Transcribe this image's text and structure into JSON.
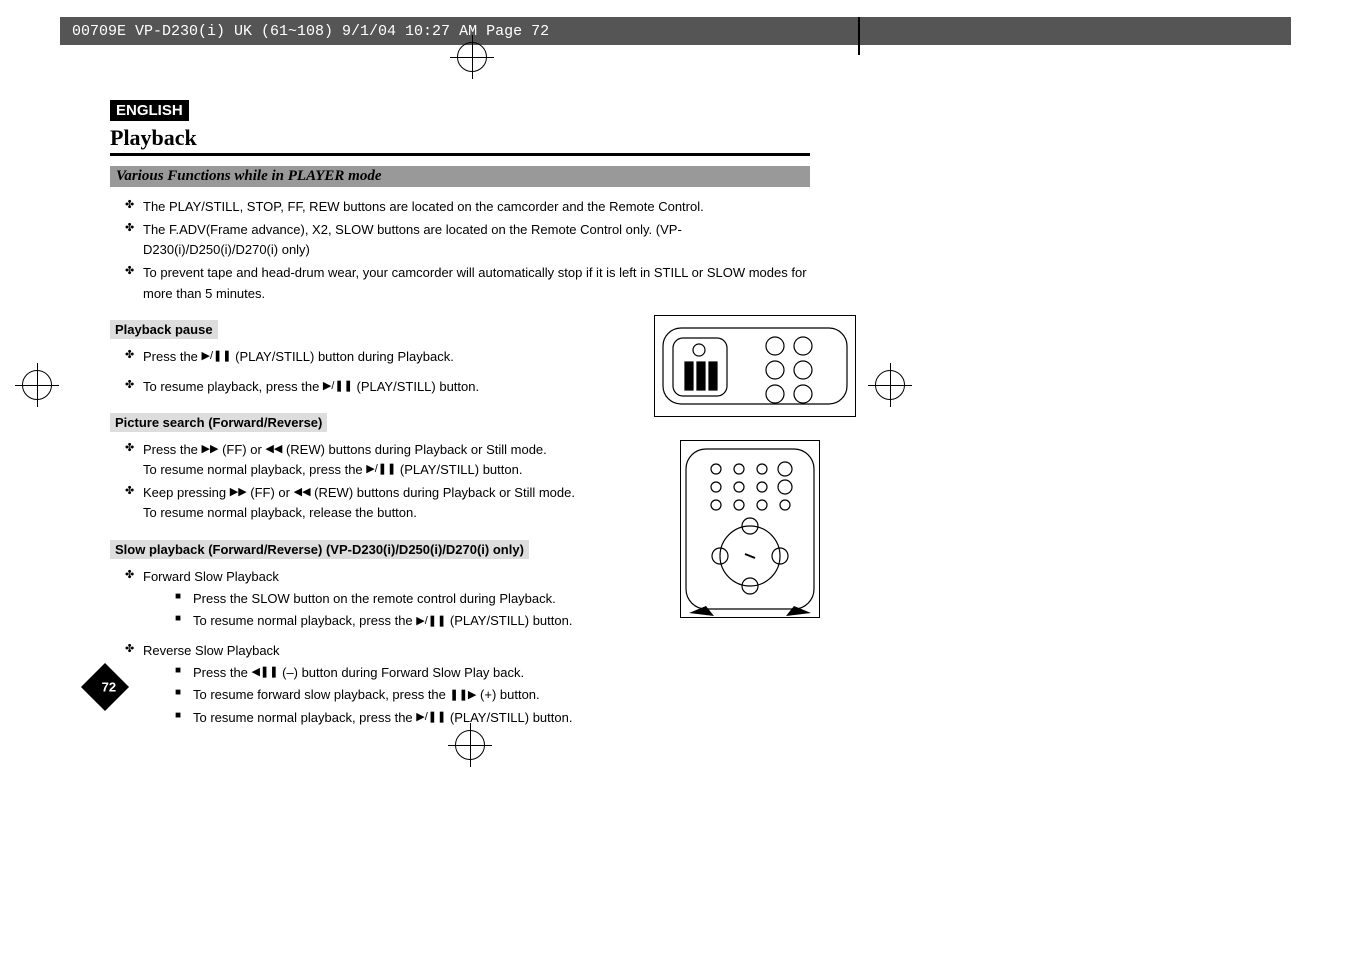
{
  "crop_header": "00709E VP-D230(i) UK (61~108)  9/1/04 10:27 AM  Page 72",
  "lang_badge": "ENGLISH",
  "main_title": "Playback",
  "section_bar": "Various Functions while in PLAYER mode",
  "intro": {
    "i0": "The PLAY/STILL, STOP, FF, REW buttons are located on the camcorder and the Remote Control.",
    "i1": "The F.ADV(Frame advance), X2, SLOW buttons are located on the Remote Control only. (VP-D230(i)/D250(i)/D270(i) only)",
    "i2": "To prevent tape and head-drum wear, your camcorder will automatically stop if it is left in STILL or SLOW modes for more than 5 minutes."
  },
  "pause": {
    "heading": "Playback pause",
    "p0a": "Press the ",
    "p0b": "(PLAY/STILL) button during Playback.",
    "p1a": "To resume playback, press the ",
    "p1b": "(PLAY/STILL) button."
  },
  "search": {
    "heading": "Picture search (Forward/Reverse)",
    "s0a": "Press the ",
    "s0b": "(FF) or ",
    "s0c": "(REW) buttons during Playback or Still mode.",
    "s0d": "To resume normal playback, press the ",
    "s0e": "(PLAY/STILL) button.",
    "s1a": "Keep pressing ",
    "s1b": "(FF) or ",
    "s1c": "(REW) buttons during Playback or Still mode.",
    "s1d": "To resume normal playback, release the button."
  },
  "slow": {
    "heading": "Slow playback (Forward/Reverse) (VP-D230(i)/D250(i)/D270(i) only)",
    "fwd_label": "Forward Slow Playback",
    "fwd_a": "Press the SLOW button on the remote control during Playback.",
    "fwd_b1": "To resume normal playback, press the ",
    "fwd_b2": "(PLAY/STILL) button.",
    "rev_label": "Reverse Slow Playback",
    "rev_a1": "Press the ",
    "rev_a2": "(–) button during Forward Slow Play back.",
    "rev_b1": "To resume forward slow playback, press the ",
    "rev_b2": "(+) button.",
    "rev_c1": "To resume normal playback, press the ",
    "rev_c2": "(PLAY/STILL) button."
  },
  "page_number": "72"
}
